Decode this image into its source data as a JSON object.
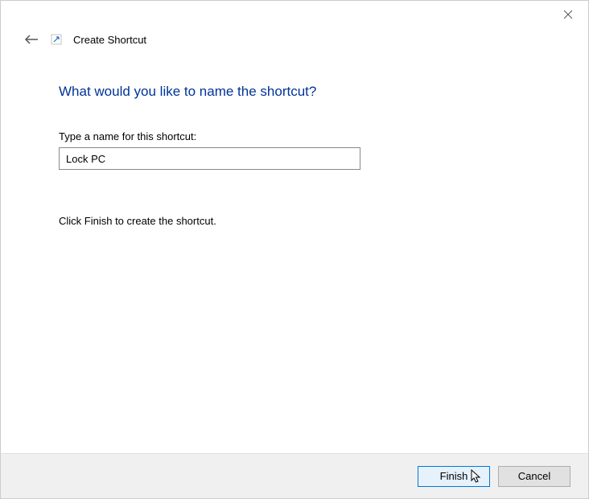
{
  "header": {
    "wizard_title": "Create Shortcut"
  },
  "main": {
    "heading": "What would you like to name the shortcut?",
    "field_label": "Type a name for this shortcut:",
    "name_value": "Lock PC",
    "instruction": "Click Finish to create the shortcut."
  },
  "footer": {
    "finish_label": "Finish",
    "cancel_label": "Cancel"
  }
}
